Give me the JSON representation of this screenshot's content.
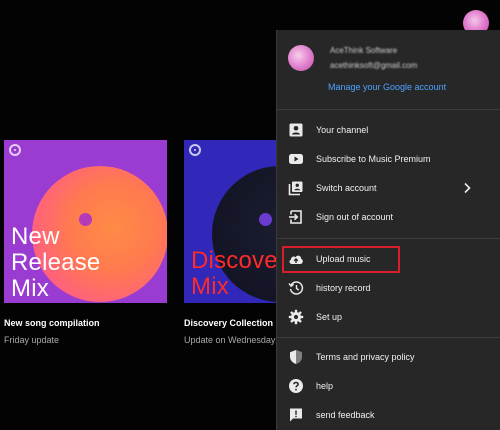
{
  "header": {
    "avatar_icon": "account-avatar-icon"
  },
  "cards": [
    {
      "art_title": "New\nRelease\nMix",
      "title": "New song compilation",
      "subtitle": "Friday update",
      "art_color": "#9a3bd2",
      "title_color": "#ffffff"
    },
    {
      "art_title": "Discover\nMix",
      "title": "Discovery Collection",
      "subtitle": "Update on Wednesday",
      "art_color": "#3127b8",
      "title_color": "#ff2a2a"
    }
  ],
  "account_menu": {
    "account_name": "AceThink Software",
    "account_email": "acethinksoft@gmail.com",
    "manage_link": "Manage your Google account",
    "link_color": "#4da3ff",
    "highlight_color": "#d81e2c",
    "sections": [
      {
        "items": [
          {
            "label": "Your channel",
            "icon": "person-icon"
          },
          {
            "label": "Subscribe to Music Premium",
            "icon": "play-icon"
          },
          {
            "label": "Switch account",
            "icon": "switch-account-icon",
            "has_submenu": true
          },
          {
            "label": "Sign out of account",
            "icon": "sign-out-icon"
          }
        ]
      },
      {
        "items": [
          {
            "label": "Upload music",
            "icon": "upload-icon",
            "highlighted": true
          },
          {
            "label": "history record",
            "icon": "history-icon"
          },
          {
            "label": "Set up",
            "icon": "gear-icon"
          }
        ]
      },
      {
        "items": [
          {
            "label": "Terms and privacy policy",
            "icon": "shield-icon"
          },
          {
            "label": "help",
            "icon": "help-icon"
          },
          {
            "label": "send feedback",
            "icon": "feedback-icon"
          }
        ]
      }
    ]
  }
}
